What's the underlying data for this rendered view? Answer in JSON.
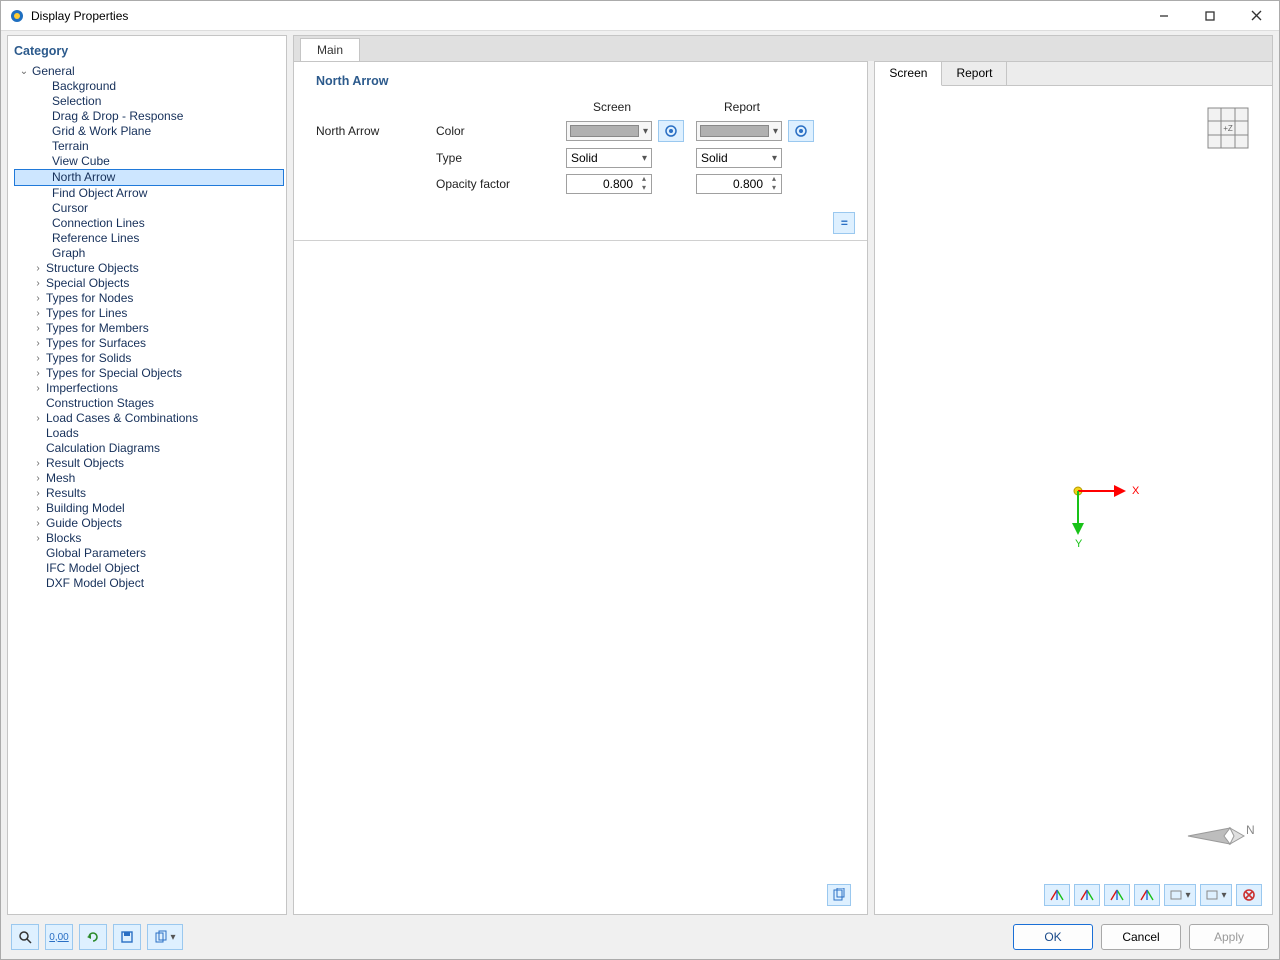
{
  "window": {
    "title": "Display Properties"
  },
  "left": {
    "header": "Category",
    "tree": {
      "general": "General",
      "general_children": [
        "Background",
        "Selection",
        "Drag & Drop - Response",
        "Grid & Work Plane",
        "Terrain",
        "View Cube",
        "North Arrow",
        "Find Object Arrow",
        "Cursor",
        "Connection Lines",
        "Reference Lines",
        "Graph"
      ],
      "selected": "North Arrow",
      "rest": [
        {
          "label": "Structure Objects",
          "exp": true
        },
        {
          "label": "Special Objects",
          "exp": true
        },
        {
          "label": "Types for Nodes",
          "exp": true
        },
        {
          "label": "Types for Lines",
          "exp": true
        },
        {
          "label": "Types for Members",
          "exp": true
        },
        {
          "label": "Types for Surfaces",
          "exp": true
        },
        {
          "label": "Types for Solids",
          "exp": true
        },
        {
          "label": "Types for Special Objects",
          "exp": true
        },
        {
          "label": "Imperfections",
          "exp": true
        },
        {
          "label": "Construction Stages",
          "exp": false
        },
        {
          "label": "Load Cases & Combinations",
          "exp": true
        },
        {
          "label": "Loads",
          "exp": false
        },
        {
          "label": "Calculation Diagrams",
          "exp": false
        },
        {
          "label": "Result Objects",
          "exp": true
        },
        {
          "label": "Mesh",
          "exp": true
        },
        {
          "label": "Results",
          "exp": true
        },
        {
          "label": "Building Model",
          "exp": true
        },
        {
          "label": "Guide Objects",
          "exp": true
        },
        {
          "label": "Blocks",
          "exp": true
        },
        {
          "label": "Global Parameters",
          "exp": false
        },
        {
          "label": "IFC Model Object",
          "exp": false
        },
        {
          "label": "DXF Model Object",
          "exp": false
        }
      ]
    }
  },
  "main": {
    "tab": "Main",
    "section": "North Arrow",
    "row_label": "North Arrow",
    "columns": {
      "screen": "Screen",
      "report": "Report"
    },
    "fields": {
      "color": "Color",
      "type": "Type",
      "opacity": "Opacity factor"
    },
    "values": {
      "screen": {
        "type": "Solid",
        "opacity": "0.800"
      },
      "report": {
        "type": "Solid",
        "opacity": "0.800"
      }
    }
  },
  "preview": {
    "tabs": {
      "screen": "Screen",
      "report": "Report"
    },
    "axes": {
      "x": "X",
      "y": "Y"
    },
    "compass": "N",
    "cube_face": "+Z",
    "toolbar": [
      "-X",
      "-Y",
      "-Z",
      "+Z"
    ]
  },
  "footer": {
    "ok": "OK",
    "cancel": "Cancel",
    "apply": "Apply"
  }
}
